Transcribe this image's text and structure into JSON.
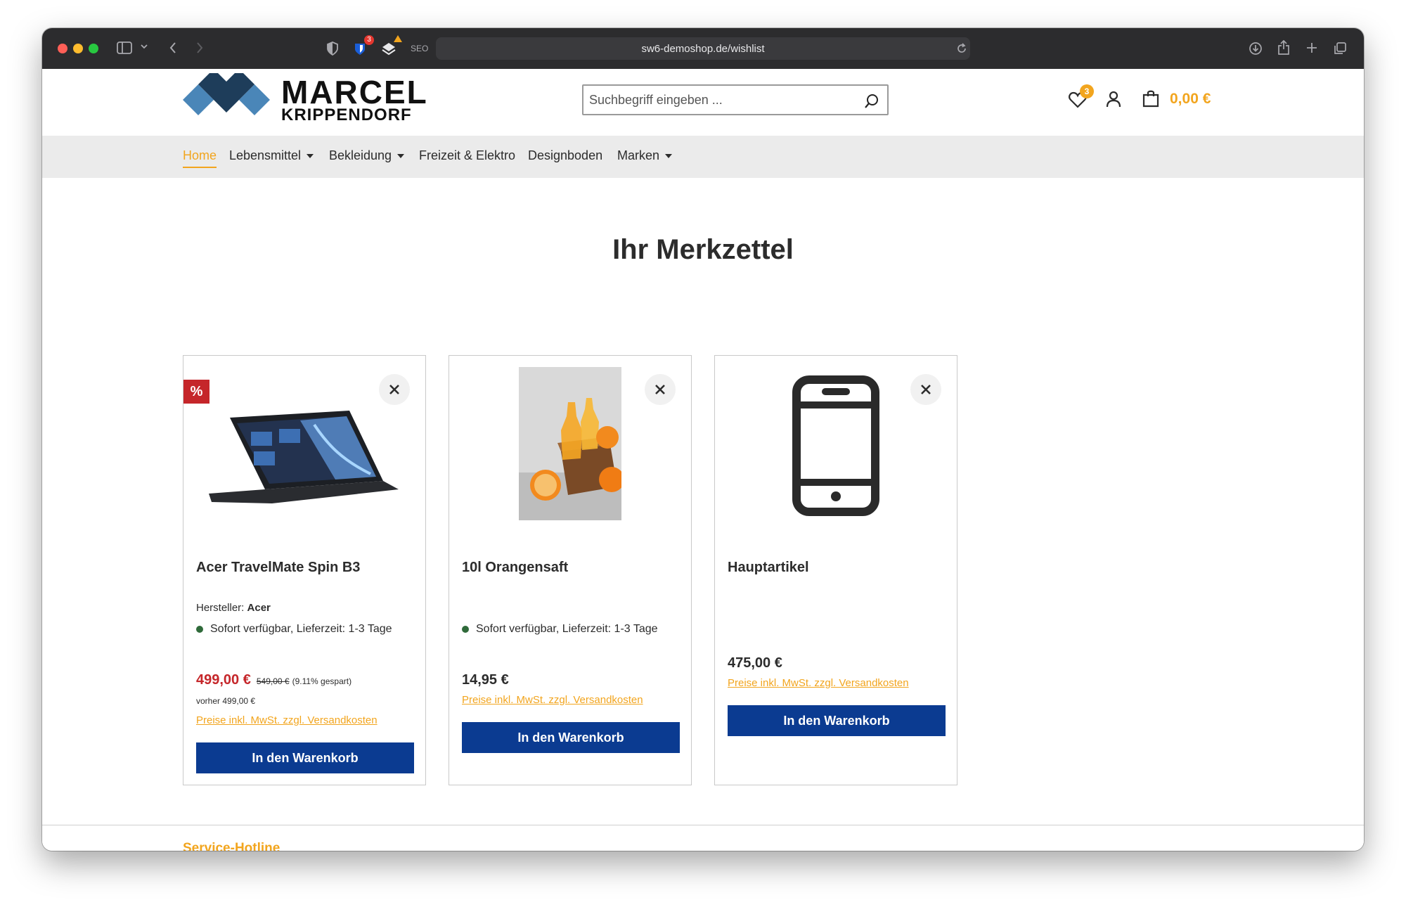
{
  "browser": {
    "url": "sw6-demoshop.de/wishlist",
    "extension_badge": "3",
    "seo_label": "SEO"
  },
  "header": {
    "logo_line1": "MARCEL",
    "logo_line2": "KRIPPENDORF",
    "search_placeholder": "Suchbegriff eingeben ...",
    "wishlist_count": "3",
    "cart_total": "0,00 €"
  },
  "nav": {
    "items": [
      {
        "label": "Home",
        "active": true
      },
      {
        "label": "Lebensmittel",
        "dropdown": true
      },
      {
        "label": "Bekleidung",
        "dropdown": true
      },
      {
        "label": "Freizeit & Elektro"
      },
      {
        "label": "Designboden"
      },
      {
        "label": "Marken",
        "dropdown": true
      }
    ]
  },
  "main": {
    "title": "Ihr Merkzettel",
    "products": [
      {
        "name": "Acer TravelMate Spin B3",
        "sale_badge": "%",
        "manufacturer_label": "Hersteller:",
        "manufacturer": "Acer",
        "availability": "Sofort verfügbar, Lieferzeit: 1-3 Tage",
        "price": "499,00 €",
        "old_price": "549,00 €",
        "saved": "(9.11% gespart)",
        "before_price": "vorher 499,00 €",
        "tax_note": "Preise inkl. MwSt. zzgl. Versandkosten",
        "button": "In den Warenkorb"
      },
      {
        "name": "10l Orangensaft",
        "availability": "Sofort verfügbar, Lieferzeit: 1-3 Tage",
        "price": "14,95 €",
        "tax_note": "Preise inkl. MwSt. zzgl. Versandkosten",
        "button": "In den Warenkorb"
      },
      {
        "name": "Hauptartikel",
        "price": "475,00 €",
        "tax_note": "Preise inkl. MwSt. zzgl. Versandkosten",
        "button": "In den Warenkorb"
      }
    ]
  },
  "footer": {
    "service_title": "Service-Hotline"
  },
  "colors": {
    "accent": "#f2a51e",
    "primary_button": "#0b3b91",
    "sale_red": "#c5262a",
    "availability_dot": "#2f6a3a"
  },
  "icons": [
    "search-icon",
    "heart-icon",
    "user-icon",
    "cart-icon",
    "close-icon",
    "sidebar-icon",
    "back-icon",
    "forward-icon",
    "reload-icon",
    "download-icon",
    "share-icon",
    "plus-icon",
    "tabs-icon"
  ]
}
